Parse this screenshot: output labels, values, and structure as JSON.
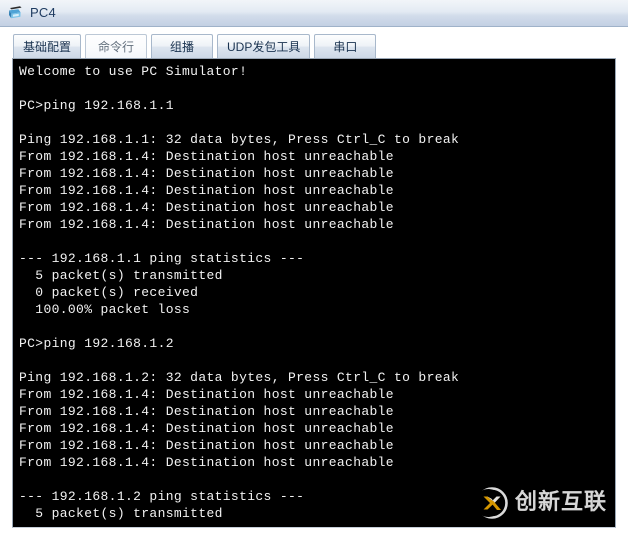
{
  "window": {
    "title": "PC4",
    "icon": "pc-computer-icon"
  },
  "tabs": [
    {
      "label": "基础配置",
      "selected": false
    },
    {
      "label": "命令行",
      "selected": true
    },
    {
      "label": "组播",
      "selected": false
    },
    {
      "label": "UDP发包工具",
      "selected": false
    },
    {
      "label": "串口",
      "selected": false
    }
  ],
  "terminal": {
    "lines": [
      "Welcome to use PC Simulator!",
      "",
      "PC>ping 192.168.1.1",
      "",
      "Ping 192.168.1.1: 32 data bytes, Press Ctrl_C to break",
      "From 192.168.1.4: Destination host unreachable",
      "From 192.168.1.4: Destination host unreachable",
      "From 192.168.1.4: Destination host unreachable",
      "From 192.168.1.4: Destination host unreachable",
      "From 192.168.1.4: Destination host unreachable",
      "",
      "--- 192.168.1.1 ping statistics ---",
      "  5 packet(s) transmitted",
      "  0 packet(s) received",
      "  100.00% packet loss",
      "",
      "PC>ping 192.168.1.2",
      "",
      "Ping 192.168.1.2: 32 data bytes, Press Ctrl_C to break",
      "From 192.168.1.4: Destination host unreachable",
      "From 192.168.1.4: Destination host unreachable",
      "From 192.168.1.4: Destination host unreachable",
      "From 192.168.1.4: Destination host unreachable",
      "From 192.168.1.4: Destination host unreachable",
      "",
      "--- 192.168.1.2 ping statistics ---",
      "  5 packet(s) transmitted"
    ]
  },
  "watermark": {
    "text": "创新互联",
    "logo": "cx-circle-logo"
  },
  "colors": {
    "terminal_bg": "#000000",
    "terminal_fg": "#f2f2f2",
    "titlebar_text": "#1f3c61",
    "tab_border": "#a8b8cb",
    "watermark_accent": "#e8a400"
  }
}
